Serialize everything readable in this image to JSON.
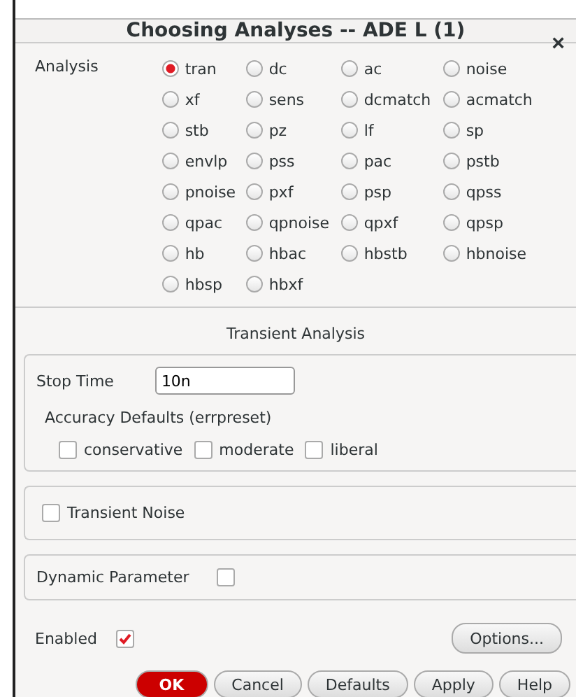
{
  "window": {
    "title": "Choosing Analyses -- ADE L (1)",
    "close": "×"
  },
  "analysis": {
    "label": "Analysis",
    "options": [
      {
        "label": "tran",
        "selected": true
      },
      {
        "label": "dc",
        "selected": false
      },
      {
        "label": "ac",
        "selected": false
      },
      {
        "label": "noise",
        "selected": false
      },
      {
        "label": "xf",
        "selected": false
      },
      {
        "label": "sens",
        "selected": false
      },
      {
        "label": "dcmatch",
        "selected": false
      },
      {
        "label": "acmatch",
        "selected": false
      },
      {
        "label": "stb",
        "selected": false
      },
      {
        "label": "pz",
        "selected": false
      },
      {
        "label": "lf",
        "selected": false
      },
      {
        "label": "sp",
        "selected": false
      },
      {
        "label": "envlp",
        "selected": false
      },
      {
        "label": "pss",
        "selected": false
      },
      {
        "label": "pac",
        "selected": false
      },
      {
        "label": "pstb",
        "selected": false
      },
      {
        "label": "pnoise",
        "selected": false
      },
      {
        "label": "pxf",
        "selected": false
      },
      {
        "label": "psp",
        "selected": false
      },
      {
        "label": "qpss",
        "selected": false
      },
      {
        "label": "qpac",
        "selected": false
      },
      {
        "label": "qpnoise",
        "selected": false
      },
      {
        "label": "qpxf",
        "selected": false
      },
      {
        "label": "qpsp",
        "selected": false
      },
      {
        "label": "hb",
        "selected": false
      },
      {
        "label": "hbac",
        "selected": false
      },
      {
        "label": "hbstb",
        "selected": false
      },
      {
        "label": "hbnoise",
        "selected": false
      },
      {
        "label": "hbsp",
        "selected": false
      },
      {
        "label": "hbxf",
        "selected": false
      }
    ]
  },
  "section_title": "Transient Analysis",
  "stop_time": {
    "label": "Stop Time",
    "value": "10n"
  },
  "accuracy": {
    "label": "Accuracy Defaults (errpreset)",
    "options": [
      {
        "label": "conservative",
        "checked": false
      },
      {
        "label": "moderate",
        "checked": false
      },
      {
        "label": "liberal",
        "checked": false
      }
    ]
  },
  "transient_noise": {
    "label": "Transient Noise",
    "checked": false
  },
  "dynamic_parameter": {
    "label": "Dynamic Parameter",
    "checked": false
  },
  "enabled": {
    "label": "Enabled",
    "checked": true
  },
  "options_button": "Options...",
  "buttons": [
    {
      "label": "OK",
      "kind": "primary"
    },
    {
      "label": "Cancel",
      "kind": "normal"
    },
    {
      "label": "Defaults",
      "kind": "normal"
    },
    {
      "label": "Apply",
      "kind": "normal"
    },
    {
      "label": "Help",
      "kind": "normal"
    }
  ]
}
